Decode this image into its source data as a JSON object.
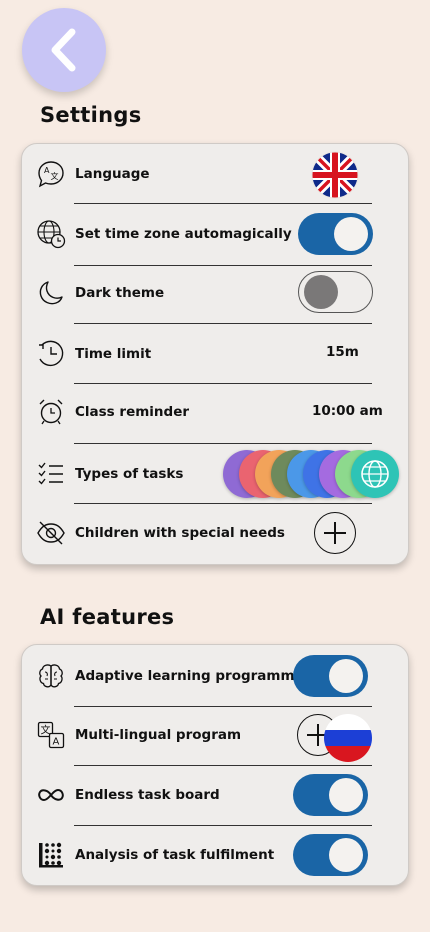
{
  "header": {
    "back_icon": "chevron-left-icon"
  },
  "settings": {
    "title": "Settings",
    "rows": [
      {
        "label": "Language",
        "icon": "language-icon"
      },
      {
        "label": "Set time zone automagically",
        "icon": "globe-clock-icon",
        "toggle": true
      },
      {
        "label": "Dark theme",
        "icon": "moon-icon",
        "toggle": false
      },
      {
        "label": "Time limit",
        "icon": "clock-icon",
        "value": "15m"
      },
      {
        "label": "Class reminder",
        "icon": "alarm-clock-icon",
        "value": "10:00 am"
      },
      {
        "label": "Types of tasks",
        "icon": "checklist-icon"
      },
      {
        "label": "Children with special needs",
        "icon": "eye-slash-icon"
      }
    ]
  },
  "ai": {
    "title": "AI features",
    "rows": [
      {
        "label": "Adaptive learning programmes",
        "icon": "brain-icon",
        "toggle": true
      },
      {
        "label": "Multi-lingual program",
        "icon": "translate-icon"
      },
      {
        "label": "Endless task board",
        "icon": "infinity-icon",
        "toggle": true
      },
      {
        "label": "Analysis of task fulfilment",
        "icon": "dot-matrix-icon",
        "toggle": true
      }
    ]
  },
  "colors": {
    "background": "#f7ebe3",
    "card": "#efedeb",
    "toggle_on": "#1a65a6",
    "back_button": "#c8c5f5",
    "task_type_chips": [
      "#8f6ad4",
      "#ea6470",
      "#f2a35a",
      "#6e8a5c",
      "#4b98e8",
      "#3f73e6",
      "#a46be0",
      "#8dd98d",
      "#2ec4b6"
    ]
  }
}
